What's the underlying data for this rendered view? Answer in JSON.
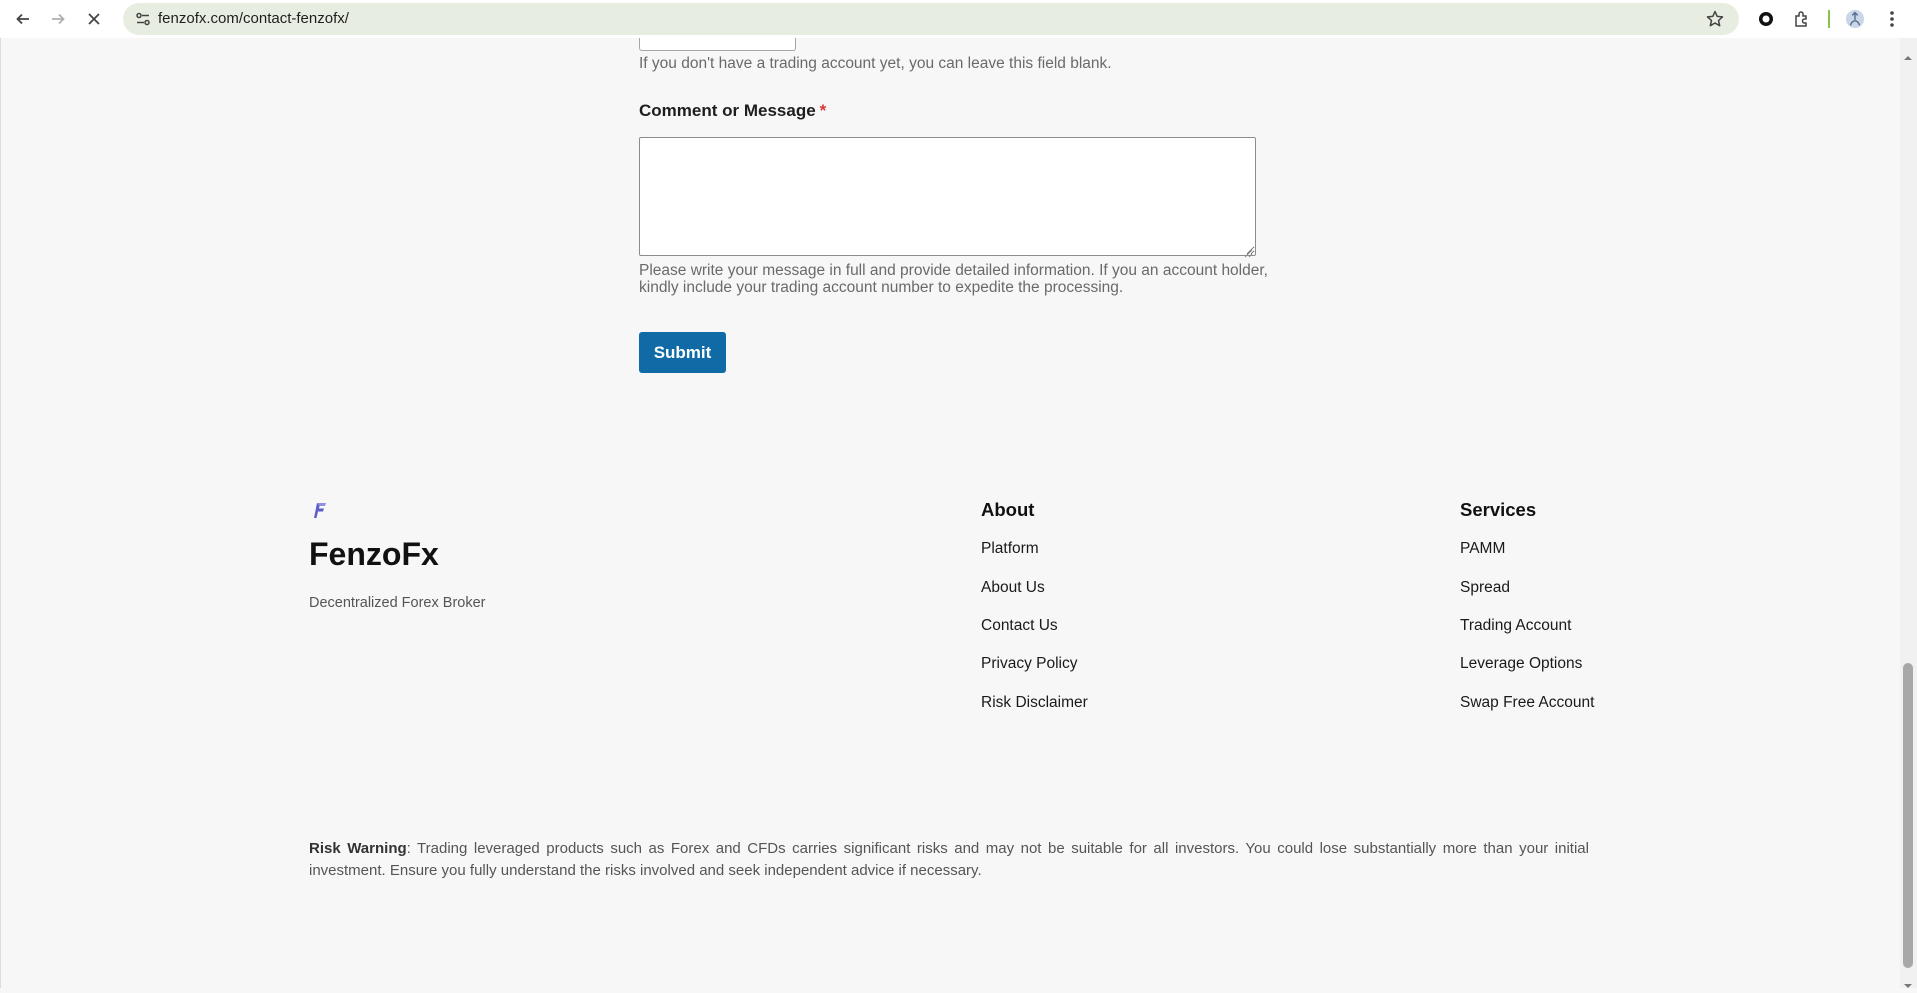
{
  "browser": {
    "url": "fenzofx.com/contact-fenzofx/",
    "icons": [
      "back-arrow-icon",
      "forward-arrow-icon",
      "stop-loading-icon",
      "site-info-icon",
      "bookmark-star-icon",
      "extension-ring-icon",
      "puzzle-extensions-icon",
      "profile-avatar-icon",
      "kebab-menu-icon"
    ]
  },
  "form": {
    "account_hint": "If you don't have a trading account yet, you can leave this field blank.",
    "message_label": "Comment or Message",
    "required_mark": "*",
    "message_value": "",
    "message_hint_line1": "Please write your message in full and provide detailed information. If you an account holder,",
    "message_hint_line2": "kindly include your trading account number to expedite the processing.",
    "submit_label": "Submit",
    "submit_color": "#0f6aa6"
  },
  "footer": {
    "brand": "FenzoFx",
    "tagline": "Decentralized Forex Broker",
    "about": {
      "heading": "About",
      "links": [
        "Platform",
        "About Us",
        "Contact Us",
        "Privacy Policy",
        "Risk Disclaimer"
      ]
    },
    "services": {
      "heading": "Services",
      "links": [
        "PAMM",
        "Spread",
        "Trading Account",
        "Leverage Options",
        "Swap Free Account"
      ]
    },
    "risk_label": "Risk Warning",
    "risk_text": ": Trading leveraged products such as Forex and CFDs carries significant risks and may not be suitable for all investors. You could lose substantially more than your initial investment. Ensure you fully understand the risks involved and seek independent advice if necessary."
  }
}
